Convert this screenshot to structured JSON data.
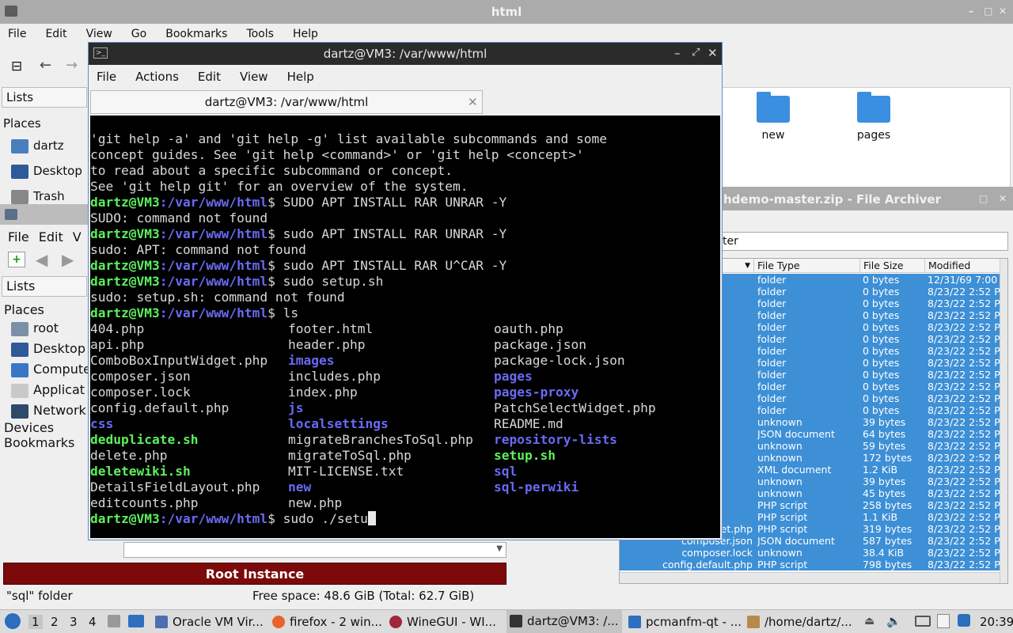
{
  "fm_back": {
    "title": "html",
    "menu": [
      "File",
      "Edit",
      "View",
      "Go",
      "Bookmarks",
      "Tools",
      "Help"
    ],
    "sidebar_header": "Lists",
    "places_label": "Places",
    "places": [
      "dartz",
      "Desktop",
      "Trash"
    ],
    "folders": [
      "new",
      "pages"
    ]
  },
  "pcmanfm": {
    "menu": [
      "File",
      "Edit",
      "V"
    ],
    "sidebar_header": "Lists",
    "places_label": "Places",
    "places": [
      "root",
      "Desktop",
      "Compute",
      "Applicat",
      "Network"
    ],
    "devices_label": "Devices",
    "bookmarks_label": "Bookmarks",
    "root_banner": "Root Instance",
    "status_left": "\"sql\" folder",
    "status_right": "Free space: 48.6 GiB (Total: 62.7 GiB)"
  },
  "archiver": {
    "title": "hdemo-master.zip - File Archiver",
    "filter_text": "ter",
    "columns": [
      "File Type",
      "File Size",
      "Modified"
    ],
    "rows": [
      {
        "name": "",
        "type": "folder",
        "size": "0 bytes",
        "modified": "12/31/69 7:00 P"
      },
      {
        "name": "",
        "type": "folder",
        "size": "0 bytes",
        "modified": "8/23/22 2:52 PI"
      },
      {
        "name": "",
        "type": "folder",
        "size": "0 bytes",
        "modified": "8/23/22 2:52 PI"
      },
      {
        "name": "",
        "type": "folder",
        "size": "0 bytes",
        "modified": "8/23/22 2:52 PI"
      },
      {
        "name": "",
        "type": "folder",
        "size": "0 bytes",
        "modified": "8/23/22 2:52 PI"
      },
      {
        "name": "",
        "type": "folder",
        "size": "0 bytes",
        "modified": "8/23/22 2:52 PI"
      },
      {
        "name": "",
        "type": "folder",
        "size": "0 bytes",
        "modified": "8/23/22 2:52 PI"
      },
      {
        "name": "",
        "type": "folder",
        "size": "0 bytes",
        "modified": "8/23/22 2:52 PI"
      },
      {
        "name": "",
        "type": "folder",
        "size": "0 bytes",
        "modified": "8/23/22 2:52 PI"
      },
      {
        "name": "",
        "type": "folder",
        "size": "0 bytes",
        "modified": "8/23/22 2:52 PI"
      },
      {
        "name": "",
        "type": "folder",
        "size": "0 bytes",
        "modified": "8/23/22 2:52 PI"
      },
      {
        "name": "",
        "type": "folder",
        "size": "0 bytes",
        "modified": "8/23/22 2:52 PI"
      },
      {
        "name": "",
        "type": "unknown",
        "size": "39 bytes",
        "modified": "8/23/22 2:52 PI"
      },
      {
        "name": "",
        "type": "JSON document",
        "size": "64 bytes",
        "modified": "8/23/22 2:52 PI"
      },
      {
        "name": "",
        "type": "unknown",
        "size": "59 bytes",
        "modified": "8/23/22 2:52 PI"
      },
      {
        "name": "",
        "type": "unknown",
        "size": "172 bytes",
        "modified": "8/23/22 2:52 PI"
      },
      {
        "name": "",
        "type": "XML document",
        "size": "1.2 KiB",
        "modified": "8/23/22 2:52 PI"
      },
      {
        "name": "",
        "type": "unknown",
        "size": "39 bytes",
        "modified": "8/23/22 2:52 PI"
      },
      {
        "name": "",
        "type": "unknown",
        "size": "45 bytes",
        "modified": "8/23/22 2:52 PI"
      },
      {
        "name": "",
        "type": "PHP script",
        "size": "258 bytes",
        "modified": "8/23/22 2:52 PI"
      },
      {
        "name": "",
        "type": "PHP script",
        "size": "1.1 KiB",
        "modified": "8/23/22 2:52 PI"
      },
      {
        "name": "et.php",
        "type": "PHP script",
        "size": "319 bytes",
        "modified": "8/23/22 2:52 PI"
      },
      {
        "name": "composer.json",
        "type": "JSON document",
        "size": "587 bytes",
        "modified": "8/23/22 2:52 PI"
      },
      {
        "name": "composer.lock",
        "type": "unknown",
        "size": "38.4 KiB",
        "modified": "8/23/22 2:52 PI"
      },
      {
        "name": "config.default.php",
        "type": "PHP script",
        "size": "798 bytes",
        "modified": "8/23/22 2:52 PI"
      }
    ]
  },
  "terminal": {
    "title": "dartz@VM3: /var/www/html",
    "menu": [
      "File",
      "Actions",
      "Edit",
      "View",
      "Help"
    ],
    "tab_label": "dartz@VM3: /var/www/html",
    "prompt_user": "dartz@VM3",
    "prompt_path": ":/var/www/html",
    "prompt_symbol": "$",
    "intro_lines": [
      "'git help -a' and 'git help -g' list available subcommands and some",
      "concept guides. See 'git help <command>' or 'git help <concept>'",
      "to read about a specific subcommand or concept.",
      "See 'git help git' for an overview of the system."
    ],
    "session": [
      {
        "cmd": " SUDO APT INSTALL RAR UNRAR -Y",
        "output": "SUDO: command not found"
      },
      {
        "cmd": " sudo APT INSTALL RAR UNRAR -Y",
        "output": "sudo: APT: command not found"
      },
      {
        "cmd": " sudo APT INSTALL RAR U^CAR -Y",
        "output": ""
      },
      {
        "cmd": " sudo setup.sh",
        "output": "sudo: setup.sh: command not found"
      },
      {
        "cmd": " ls",
        "output": ""
      }
    ],
    "ls_rows": [
      [
        {
          "t": "404.php",
          "k": "f"
        },
        {
          "t": "footer.html",
          "k": "f"
        },
        {
          "t": "oauth.php",
          "k": "f"
        }
      ],
      [
        {
          "t": "api.php",
          "k": "f"
        },
        {
          "t": "header.php",
          "k": "f"
        },
        {
          "t": "package.json",
          "k": "f"
        }
      ],
      [
        {
          "t": "ComboBoxInputWidget.php",
          "k": "f"
        },
        {
          "t": "images",
          "k": "d"
        },
        {
          "t": "package-lock.json",
          "k": "f"
        }
      ],
      [
        {
          "t": "composer.json",
          "k": "f"
        },
        {
          "t": "includes.php",
          "k": "f"
        },
        {
          "t": "pages",
          "k": "d"
        }
      ],
      [
        {
          "t": "composer.lock",
          "k": "f"
        },
        {
          "t": "index.php",
          "k": "f"
        },
        {
          "t": "pages-proxy",
          "k": "d"
        }
      ],
      [
        {
          "t": "config.default.php",
          "k": "f"
        },
        {
          "t": "js",
          "k": "d"
        },
        {
          "t": "PatchSelectWidget.php",
          "k": "f"
        }
      ],
      [
        {
          "t": "css",
          "k": "d"
        },
        {
          "t": "localsettings",
          "k": "d"
        },
        {
          "t": "README.md",
          "k": "f"
        }
      ],
      [
        {
          "t": "deduplicate.sh",
          "k": "x"
        },
        {
          "t": "migrateBranchesToSql.php",
          "k": "f"
        },
        {
          "t": "repository-lists",
          "k": "d"
        }
      ],
      [
        {
          "t": "delete.php",
          "k": "f"
        },
        {
          "t": "migrateToSql.php",
          "k": "f"
        },
        {
          "t": "setup.sh",
          "k": "x"
        }
      ],
      [
        {
          "t": "deletewiki.sh",
          "k": "x"
        },
        {
          "t": "MIT-LICENSE.txt",
          "k": "f"
        },
        {
          "t": "sql",
          "k": "d"
        }
      ],
      [
        {
          "t": "DetailsFieldLayout.php",
          "k": "f"
        },
        {
          "t": "new",
          "k": "d"
        },
        {
          "t": "sql-perwiki",
          "k": "d"
        }
      ],
      [
        {
          "t": "editcounts.php",
          "k": "f"
        },
        {
          "t": "new.php",
          "k": "f"
        },
        {
          "t": "",
          "k": "f"
        }
      ]
    ],
    "current_input": " sudo ./setu"
  },
  "taskbar": {
    "workspaces": [
      "1",
      "2",
      "3",
      "4"
    ],
    "tasks": [
      "Oracle VM Vir...",
      "firefox - 2 win...",
      "WineGUI - WI...",
      "dartz@VM3: /...",
      "pcmanfm-qt - ...",
      "/home/dartz/..."
    ],
    "clock": "20:39"
  },
  "colors": {
    "accent": "#3d8fd6",
    "root_banner": "#7c0a0a",
    "prompt_user": "#5cf05c",
    "prompt_path": "#6a6af4"
  }
}
